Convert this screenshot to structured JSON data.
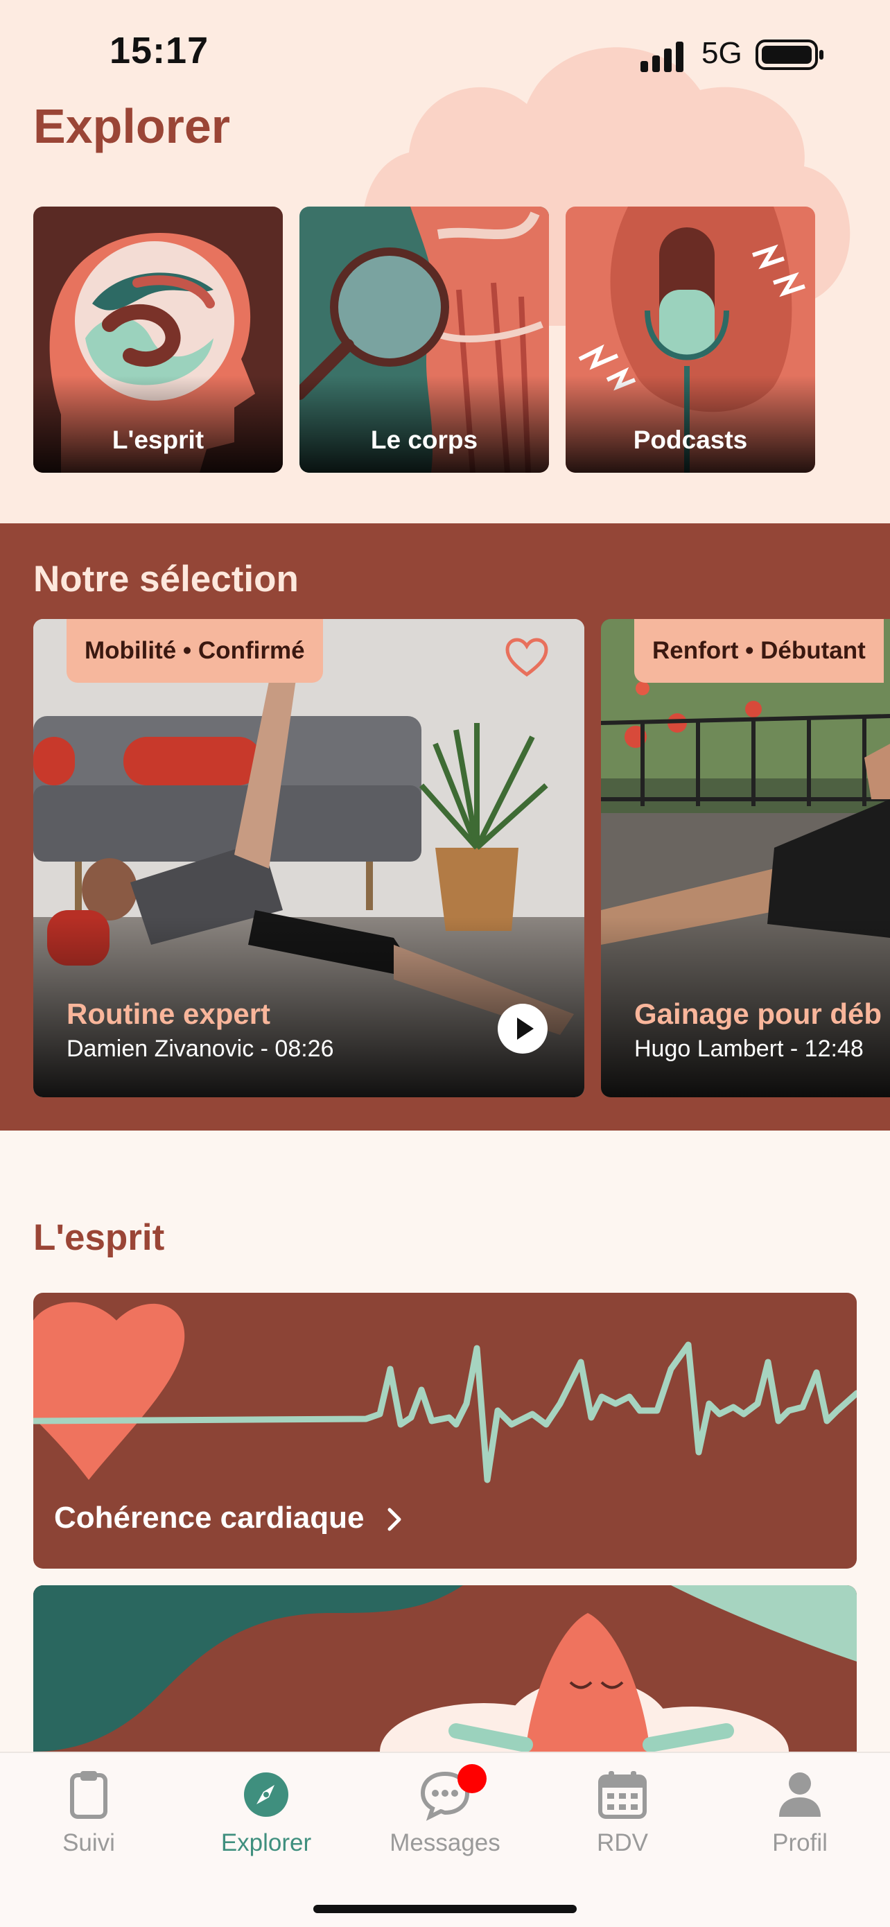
{
  "status_bar": {
    "time": "15:17",
    "network": "5G"
  },
  "page_title": "Explorer",
  "categories": [
    {
      "label": "L'esprit"
    },
    {
      "label": "Le corps"
    },
    {
      "label": "Podcasts"
    }
  ],
  "selection": {
    "title": "Notre sélection",
    "cards": [
      {
        "tag": "Mobilité • Confirmé",
        "title": "Routine expert",
        "subtitle": "Damien Zivanovic - 08:26",
        "favorite": false
      },
      {
        "tag": "Renfort • Débutant",
        "title": "Gainage pour déb",
        "subtitle": "Hugo Lambert - 12:48"
      }
    ]
  },
  "esprit": {
    "title": "L'esprit",
    "items": [
      {
        "label": "Cohérence cardiaque"
      }
    ]
  },
  "tabbar": {
    "tabs": [
      {
        "label": "Suivi",
        "icon": "clipboard-icon"
      },
      {
        "label": "Explorer",
        "icon": "compass-icon",
        "active": true
      },
      {
        "label": "Messages",
        "icon": "chat-bubble-icon",
        "badge": true
      },
      {
        "label": "RDV",
        "icon": "calendar-icon"
      },
      {
        "label": "Profil",
        "icon": "person-icon"
      }
    ]
  },
  "colors": {
    "brand_brown": "#944637",
    "accent_green": "#3f8f7e",
    "salmon": "#f6b79d",
    "badge_red": "#ff0000"
  }
}
